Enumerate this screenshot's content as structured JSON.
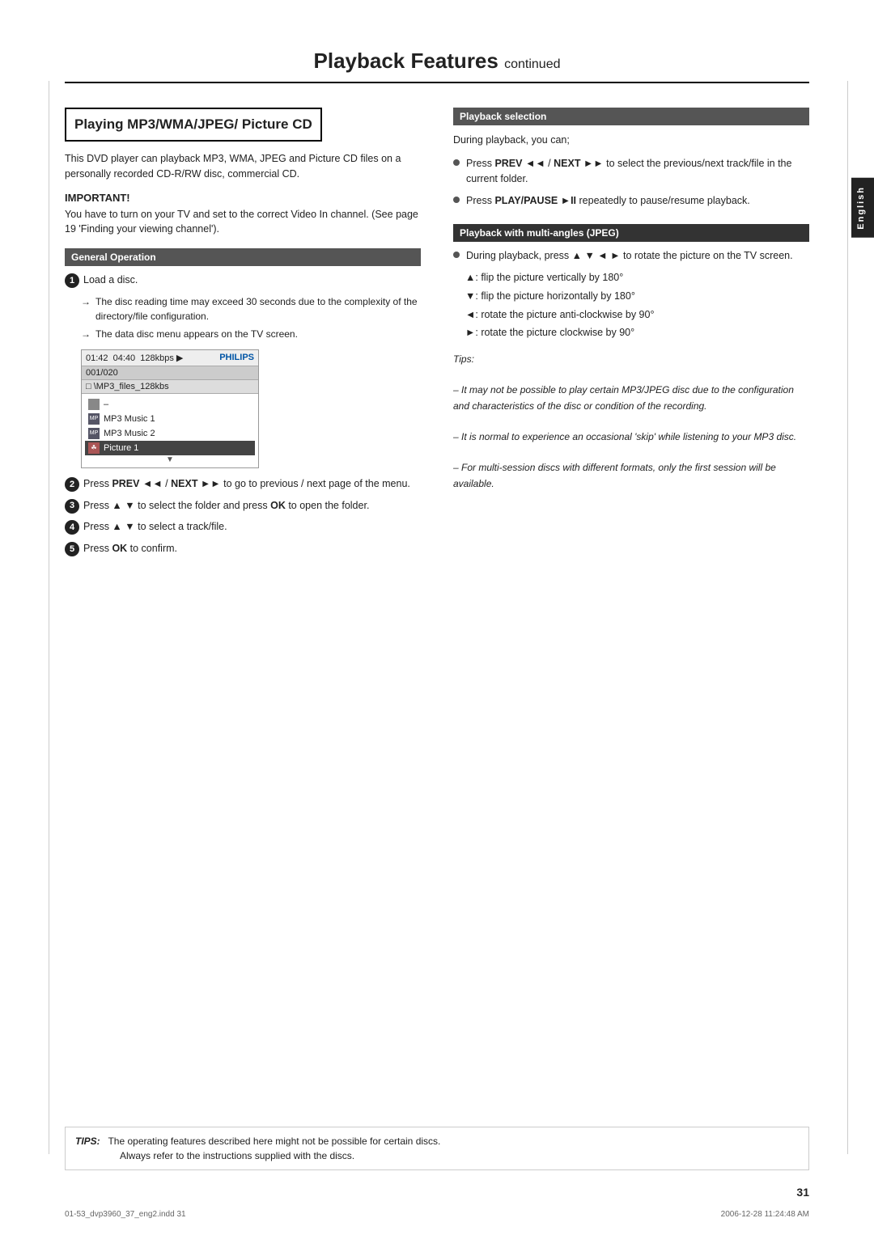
{
  "page": {
    "title": "Playback Features",
    "title_continued": "continued",
    "left_section_title": "Playing MP3/WMA/JPEG/ Picture CD",
    "intro": "This DVD player can playback MP3, WMA, JPEG and Picture CD files on a personally recorded CD-R/RW disc, commercial CD.",
    "important_label": "IMPORTANT!",
    "important_text": "You have to turn on your TV and set to the correct Video In channel.  (See page 19 'Finding your viewing channel').",
    "general_op_label": "General Operation",
    "steps": [
      {
        "num": "1",
        "text": "Load a disc."
      },
      {
        "num": "2",
        "text_prefix": "Press ",
        "bold1": "PREV",
        "mid1": " / ",
        "bold2": "NEXT",
        "text_suffix": " to go to previous / next page of the menu."
      },
      {
        "num": "3",
        "text_prefix": "Press ▲ ▼ to select the folder and press ",
        "bold1": "OK",
        "text_suffix": " to open the folder."
      },
      {
        "num": "4",
        "text": "Press ▲ ▼ to select a track/file."
      },
      {
        "num": "5",
        "text_prefix": "Press ",
        "bold1": "OK",
        "text_suffix": " to confirm."
      }
    ],
    "arrow_items": [
      "The disc reading time may exceed 30 seconds due to the complexity of the directory/file configuration.",
      "The data disc menu appears on the TV screen."
    ],
    "screen": {
      "time": "01:42",
      "duration": "04:40",
      "bitrate": "128kbps",
      "track": "001/020",
      "folder": "\\MP3_files_128kbs",
      "items": [
        {
          "type": "folder",
          "name": "–",
          "selected": false
        },
        {
          "type": "mp3",
          "name": "MP3 Music 1",
          "selected": false
        },
        {
          "type": "mp3",
          "name": "MP3 Music 2",
          "selected": false
        },
        {
          "type": "pic",
          "name": "Picture 1",
          "selected": true
        }
      ],
      "philips": "PHILIPS"
    },
    "right_sections": {
      "playback_selection": {
        "label": "Playback selection",
        "intro": "During playback, you can;",
        "bullets": [
          {
            "text_prefix": "Press ",
            "bold1": "PREV",
            "sym1": "◄◄",
            "mid": " / ",
            "bold2": "NEXT",
            "sym2": "►►",
            "text_suffix": " to select the previous/next track/file in the current folder."
          },
          {
            "text_prefix": "Press ",
            "bold1": "PLAY/PAUSE",
            "sym": "►II",
            "text_suffix": " repeatedly to pause/resume playback."
          }
        ]
      },
      "playback_multi": {
        "label": "Playback with multi-angles (JPEG)",
        "intro": "During playback, press ▲ ▼ ◄ ► to rotate the picture on the TV screen.",
        "sub_items": [
          "▲: flip the picture vertically by 180°",
          "▼: flip the picture horizontally by 180°",
          "◄: rotate the picture anti-clockwise by 90°",
          "►: rotate the picture clockwise by 90°"
        ],
        "tips_label": "Tips:",
        "tips": [
          "– It may not be possible to play certain MP3/JPEG disc due to the configuration and characteristics of the disc or condition of the recording.",
          "– It is normal to experience an occasional 'skip' while listening to your MP3 disc.",
          "– For multi-session discs with different formats, only the first session will be available."
        ]
      }
    },
    "footer": {
      "tips_label": "TIPS:",
      "tips_text": "The operating features described here might not be possible for certain discs.",
      "tips_text2": "Always refer to the instructions supplied with the discs.",
      "page_number": "31",
      "file_info": "01-53_dvp3960_37_eng2.indd  31",
      "date_info": "2006-12-28   11:24:48 AM"
    },
    "english_tab": "English"
  }
}
